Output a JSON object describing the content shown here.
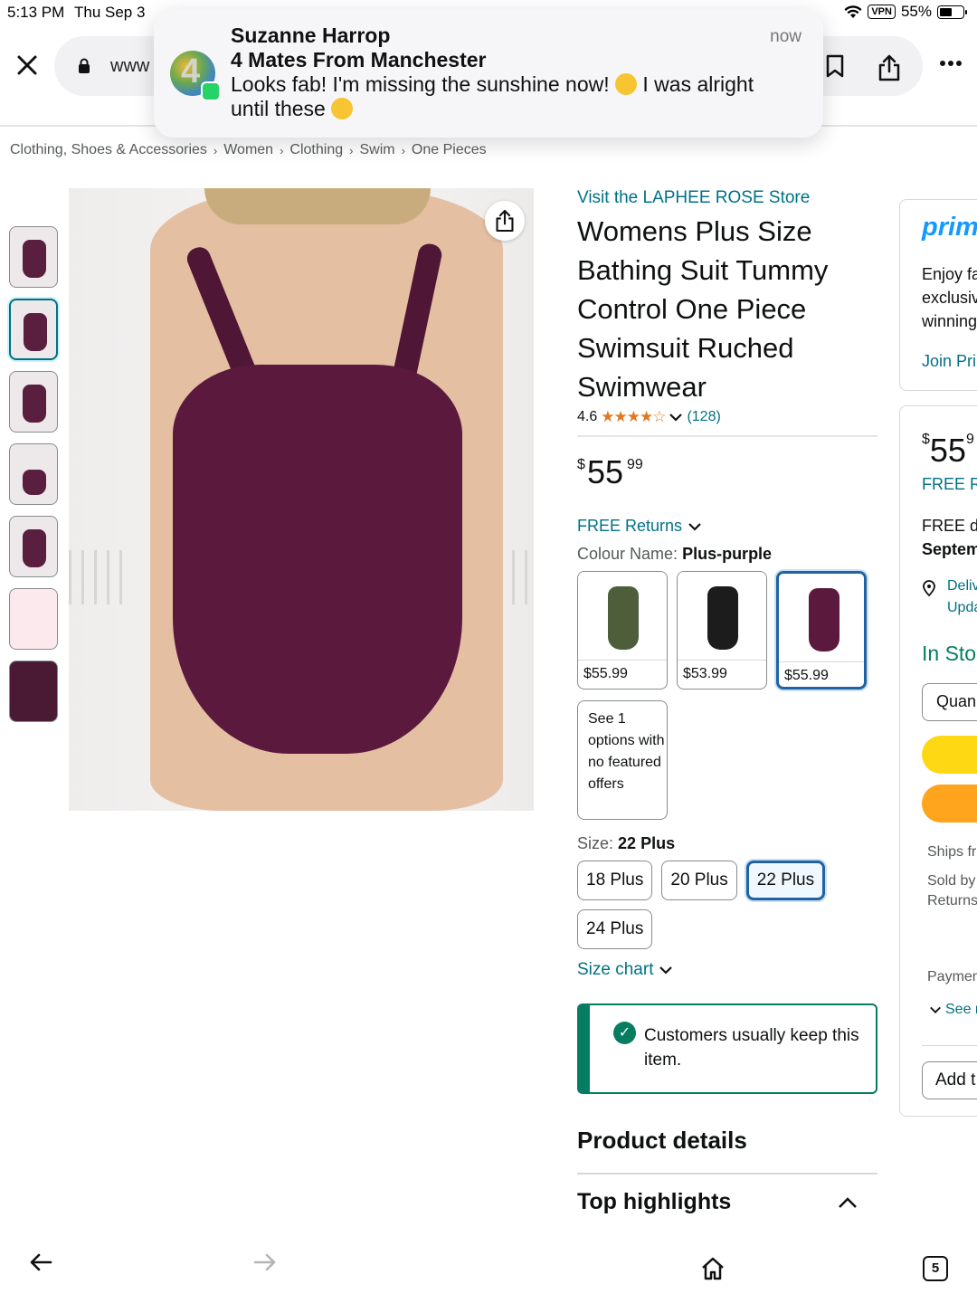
{
  "status_bar": {
    "time": "5:13 PM",
    "date": "Thu Sep 3",
    "vpn": "VPN",
    "battery": "55%"
  },
  "browser": {
    "url_text": "www",
    "tabs_count": "5"
  },
  "notification": {
    "sender": "Suzanne Harrop",
    "group": "4 Mates From Manchester",
    "message_a": "Looks fab! I'm missing the sunshine now!",
    "message_b": "I was alright",
    "message_c": "until these",
    "time": "now"
  },
  "breadcrumb": [
    "Clothing, Shoes & Accessories",
    "Women",
    "Clothing",
    "Swim",
    "One Pieces"
  ],
  "product": {
    "store_link": "Visit the LAPHEE ROSE Store",
    "title": "Womens Plus Size Bathing Suit Tummy Control One Piece Swimsuit Ruched Swimwear",
    "rating": "4.6",
    "rating_stars": 4.6,
    "stars_glyphs": "★★★★☆",
    "review_count": "(128)",
    "price_symbol": "$",
    "price_whole": "55",
    "price_fraction": "99",
    "returns": "FREE Returns",
    "colour_label": "Colour Name:",
    "colour_value": "Plus-purple",
    "colour_options": [
      {
        "price": "$55.99",
        "color": "#4f5e3a"
      },
      {
        "price": "$53.99",
        "color": "#1c1c1c"
      },
      {
        "price": "$55.99",
        "color": "#5b1a3d"
      }
    ],
    "unavailable_option": "See 1 options with no featured offers",
    "size_label": "Size:",
    "size_value": "22 Plus",
    "sizes": [
      "18 Plus",
      "20 Plus",
      "22 Plus",
      "24 Plus"
    ],
    "size_chart": "Size chart",
    "keep_message": "Customers usually keep this item.",
    "product_details": "Product details",
    "top_highlights": "Top highlights"
  },
  "buy_box": {
    "prime": "prime",
    "prime_line1": "Enjoy fa",
    "prime_line2": "exclusiv",
    "prime_line3": "winning",
    "join": "Join Pri",
    "price_symbol": "$",
    "price_whole": "55",
    "price_fraction": "9",
    "free_r": "FREE R",
    "free_de": "FREE de",
    "septem": "Septem",
    "deliv": "Deliv",
    "upda": "Upda",
    "in_stock": "In Sto",
    "quantity": "Quan",
    "ships": "Ships fr",
    "sold": "Sold by",
    "returns": "Returns",
    "payment": "Paymen",
    "see": "See r",
    "add": "Add t"
  },
  "colors": {
    "link": "#007185",
    "accent_blue": "#2162a1",
    "green": "#067d62",
    "swimsuit": "#5b1a3d"
  }
}
